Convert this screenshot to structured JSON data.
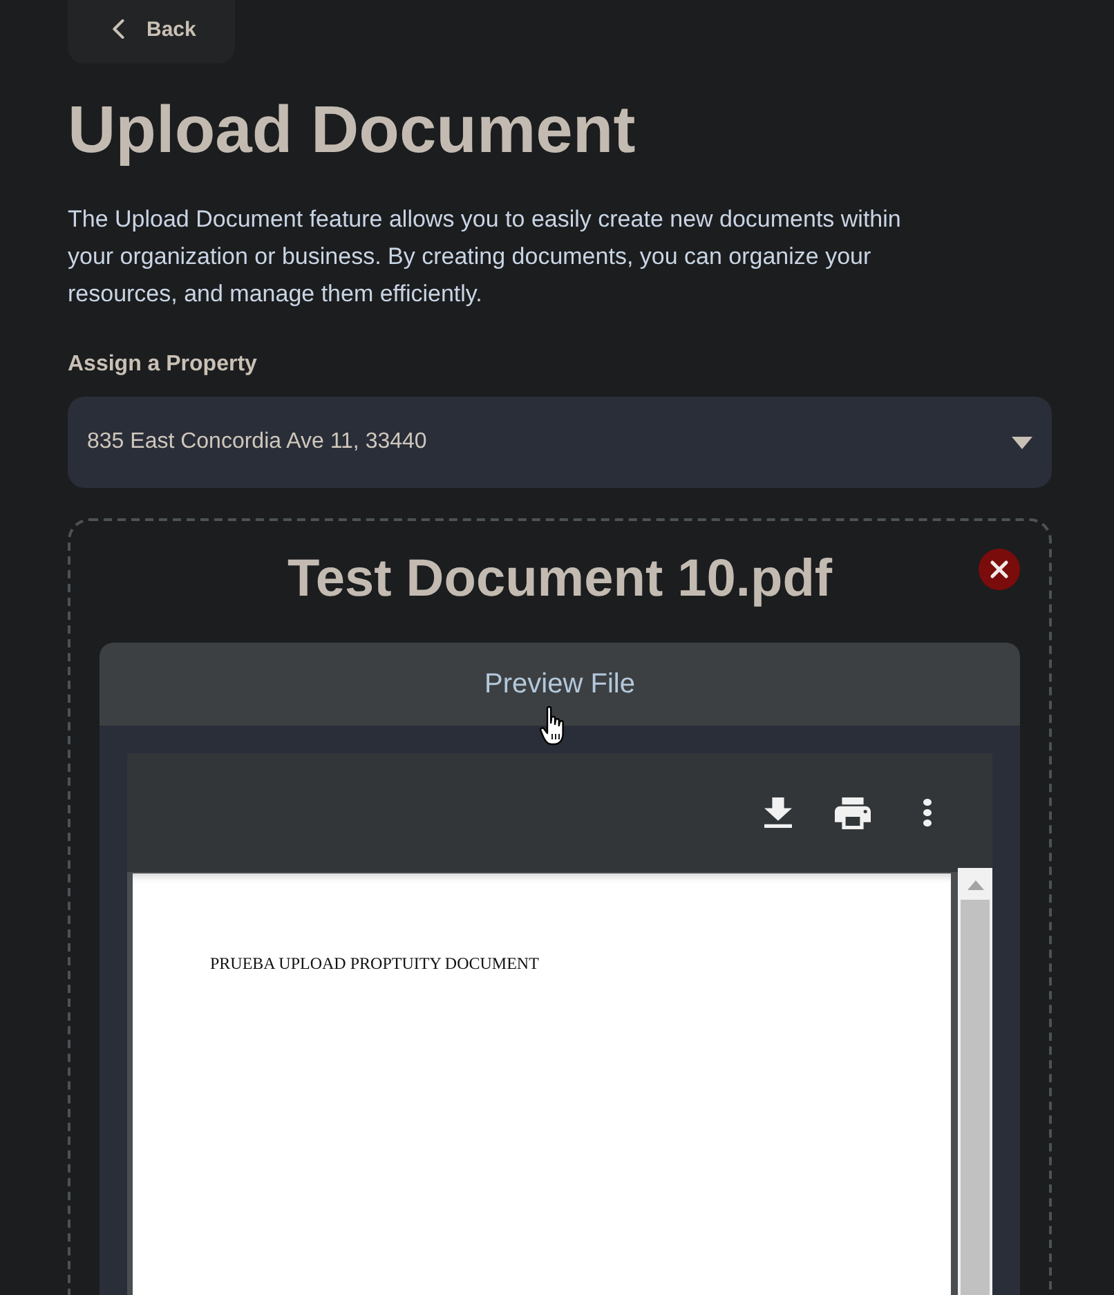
{
  "back_button": {
    "label": "Back"
  },
  "title": "Upload Document",
  "description": "The Upload Document feature allows you to easily create new documents within your organization or business. By creating documents, you can organize your resources, and manage them efficiently.",
  "property_field": {
    "label": "Assign a Property",
    "value": "835 East Concordia Ave 11, 33440"
  },
  "upload": {
    "file_name": "Test Document 10.pdf",
    "preview": {
      "header": "Preview File",
      "page_text": "PRUEBA UPLOAD PROPTUITY DOCUMENT"
    }
  }
}
